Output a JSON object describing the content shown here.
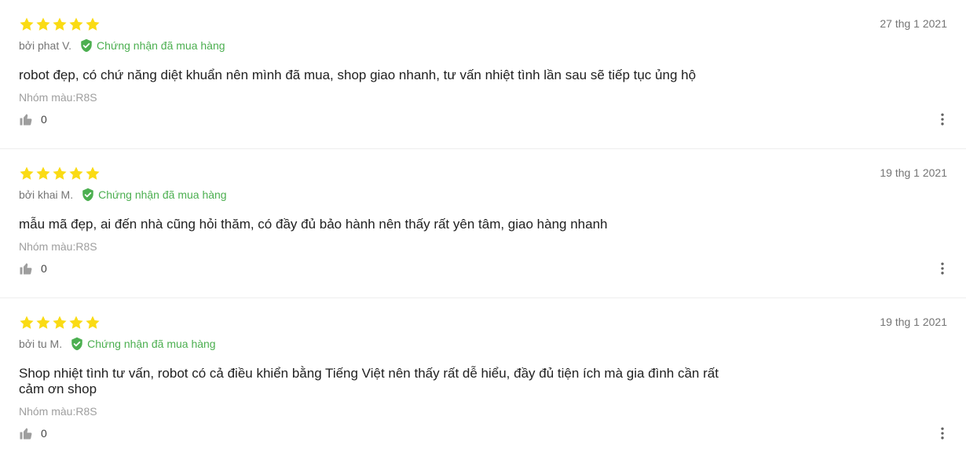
{
  "colors": {
    "star": "#fadb14",
    "verified": "#4caf50",
    "muted": "#757575"
  },
  "icons": {
    "star": "star-icon",
    "verified": "verified-shield-icon",
    "like": "thumbs-up-icon",
    "more": "more-vertical-icon"
  },
  "reviews": [
    {
      "rating": 5,
      "date": "27 thg 1 2021",
      "author": "bởi phat V.",
      "verified_label": "Chứng nhận đã mua hàng",
      "content": "robot đẹp, có chứ năng diệt khuẩn nên mình đã mua, shop giao nhanh, tư vấn nhiệt tình lần sau sẽ tiếp tục ủng hộ",
      "sku": "Nhóm màu:R8S",
      "likes": "0"
    },
    {
      "rating": 5,
      "date": "19 thg 1 2021",
      "author": "bởi khai M.",
      "verified_label": "Chứng nhận đã mua hàng",
      "content": "mẫu mã đẹp, ai đến nhà cũng hỏi thăm, có đầy đủ bảo hành nên thấy rất yên tâm, giao hàng nhanh",
      "sku": "Nhóm màu:R8S",
      "likes": "0"
    },
    {
      "rating": 5,
      "date": "19 thg 1 2021",
      "author": "bởi tu M.",
      "verified_label": "Chứng nhận đã mua hàng",
      "content": "Shop nhiệt tình tư vấn, robot có cả điều khiển bằng Tiếng Việt nên thấy rất dễ hiểu, đầy đủ tiện ích mà gia đình cần rất cảm ơn shop",
      "sku": "Nhóm màu:R8S",
      "likes": "0"
    }
  ]
}
